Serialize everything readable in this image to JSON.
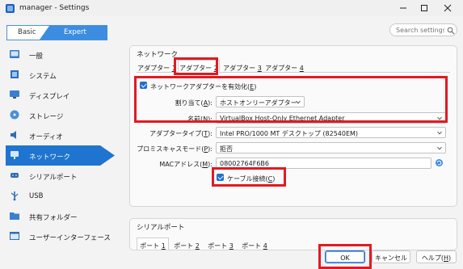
{
  "window": {
    "title": "manager - Settings"
  },
  "mode": {
    "basic": "Basic",
    "expert": "Expert"
  },
  "search": {
    "placeholder": "Search settings"
  },
  "sidebar": {
    "items": [
      {
        "label": "一般",
        "icon": "gear-icon"
      },
      {
        "label": "システム",
        "icon": "chip-icon"
      },
      {
        "label": "ディスプレイ",
        "icon": "monitor-icon"
      },
      {
        "label": "ストレージ",
        "icon": "disk-icon"
      },
      {
        "label": "オーディオ",
        "icon": "speaker-icon"
      },
      {
        "label": "ネットワーク",
        "icon": "network-icon"
      },
      {
        "label": "シリアルポート",
        "icon": "serial-port-icon"
      },
      {
        "label": "USB",
        "icon": "usb-icon"
      },
      {
        "label": "共有フォルダー",
        "icon": "folder-icon"
      },
      {
        "label": "ユーザーインターフェース",
        "icon": "window-icon"
      }
    ],
    "active_index": 5
  },
  "network": {
    "section_title": "ネットワーク",
    "tabs": [
      {
        "label": "アダプター ",
        "key": "1"
      },
      {
        "label": "アダプター ",
        "key": "2"
      },
      {
        "label": "アダプター ",
        "key": "3"
      },
      {
        "label": "アダプター ",
        "key": "4"
      }
    ],
    "active_tab": 1,
    "enable_adapter": {
      "label": "ネットワークアダプターを有効化(",
      "key": "E",
      "suffix": ")",
      "checked": true
    },
    "attached_to": {
      "label": "割り当て(",
      "key": "A",
      "suffix": "):",
      "value": "ホストオンリーアダプター"
    },
    "name": {
      "label": "名前(",
      "key": "N",
      "suffix": "):",
      "value": "VirtualBox Host-Only Ethernet Adapter"
    },
    "adapter_type": {
      "label": "アダプタータイプ(",
      "key": "T",
      "suffix": "):",
      "value": "Intel PRO/1000 MT デスクトップ (82540EM)"
    },
    "promiscuous": {
      "label": "プロミスキャスモード(",
      "key": "P",
      "suffix": "):",
      "value": "拒否"
    },
    "mac": {
      "label": "MACアドレス(",
      "key": "M",
      "suffix": "):",
      "value": "08002764F6B6"
    },
    "cable": {
      "label": "ケーブル接続(",
      "key": "C",
      "suffix": ")",
      "checked": true
    }
  },
  "serial": {
    "section_title": "シリアルポート",
    "tabs": [
      {
        "label": "ポート ",
        "key": "1"
      },
      {
        "label": "ポート ",
        "key": "2"
      },
      {
        "label": "ポート ",
        "key": "3"
      },
      {
        "label": "ポート ",
        "key": "4"
      }
    ]
  },
  "buttons": {
    "ok": "OK",
    "cancel": "キャンセル",
    "help": "ヘルプ(",
    "help_key": "H",
    "help_suffix": ")"
  },
  "colors": {
    "accent": "#1f74cf",
    "annotation": "#e11a22"
  }
}
